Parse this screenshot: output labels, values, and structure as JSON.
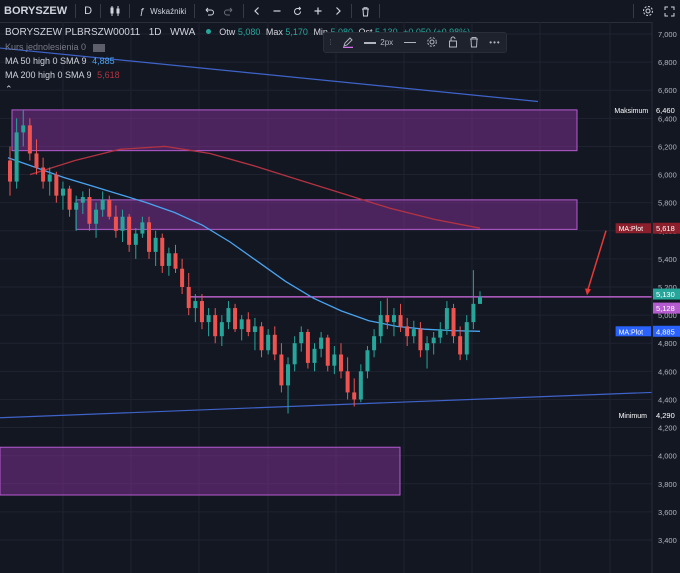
{
  "toolbar": {
    "symbol": "BORYSZEW",
    "chart_type_label": "D",
    "indicators_label": "Wskaźniki"
  },
  "legend": {
    "title": "BORYSZEW PLBRSZW00011",
    "interval": "1D",
    "exchange": "WWA",
    "open_label": "Otw",
    "open_value": "5,080",
    "high_label": "Max",
    "high_value": "5,170",
    "low_label": "Min",
    "low_value": "5,080",
    "close_label": "Ost",
    "close_value": "5,130",
    "change_text": "+0,050 (+0,98%)",
    "row2": "Kurs jednolesienia 0",
    "ma50_label": "MA 50 high 0 SMA 9",
    "ma50_value": "4,885",
    "ma200_label": "MA 200 high 0 SMA 9",
    "ma200_value": "5,618"
  },
  "float_toolbar": {
    "width_label": "2px"
  },
  "labels": {
    "maksimum": "Maksimum",
    "maksimum_value": "6,460",
    "maplot_top": "MA:Plot",
    "maplot_top_value": "5,618",
    "price_close": "5,130",
    "price_line2": "5,128",
    "maplot_bottom": "MA:Plot",
    "maplot_bottom_value": "4,885",
    "minimum": "Minimum",
    "minimum_value": "4,290"
  },
  "colors": {
    "background": "#131722",
    "up": "#26a69a",
    "down": "#ef5350",
    "ma50": "#4aa3f0",
    "ma200": "#b33342",
    "zone_fill": "#7b2f8e",
    "zone_border": "#b55bd0",
    "trendline": "#3f63c9",
    "hline": "#d66ee8",
    "arrow": "#e53935"
  },
  "chart_data": {
    "type": "candlestick",
    "ylim": [
      3.4,
      7.0
    ],
    "yticks": [
      "3,400",
      "3,600",
      "3,800",
      "4,000",
      "4,200",
      "4,400",
      "4,600",
      "4,800",
      "5,000",
      "5,200",
      "5,400",
      "5,600",
      "5,800",
      "6,000",
      "6,200",
      "6,400",
      "6,600",
      "6,800",
      "7,000"
    ],
    "yticks_values": [
      3.4,
      3.6,
      3.8,
      4.0,
      4.2,
      4.4,
      4.6,
      4.8,
      5.0,
      5.2,
      5.4,
      5.6,
      5.8,
      6.0,
      6.2,
      6.4,
      6.6,
      6.8,
      7.0
    ],
    "candles": [
      [
        6.1,
        6.2,
        5.85,
        5.95
      ],
      [
        5.95,
        6.4,
        5.9,
        6.3
      ],
      [
        6.3,
        6.46,
        6.2,
        6.35
      ],
      [
        6.35,
        6.4,
        6.1,
        6.15
      ],
      [
        6.15,
        6.25,
        6.0,
        6.05
      ],
      [
        6.05,
        6.12,
        5.9,
        5.95
      ],
      [
        5.95,
        6.05,
        5.85,
        6.0
      ],
      [
        6.0,
        6.02,
        5.8,
        5.85
      ],
      [
        5.85,
        5.95,
        5.75,
        5.9
      ],
      [
        5.9,
        5.92,
        5.7,
        5.75
      ],
      [
        5.75,
        5.85,
        5.6,
        5.8
      ],
      [
        5.8,
        5.88,
        5.72,
        5.84
      ],
      [
        5.84,
        5.9,
        5.6,
        5.65
      ],
      [
        5.65,
        5.8,
        5.55,
        5.75
      ],
      [
        5.75,
        5.88,
        5.7,
        5.82
      ],
      [
        5.82,
        5.85,
        5.68,
        5.7
      ],
      [
        5.7,
        5.78,
        5.55,
        5.6
      ],
      [
        5.6,
        5.75,
        5.52,
        5.7
      ],
      [
        5.7,
        5.72,
        5.45,
        5.5
      ],
      [
        5.5,
        5.62,
        5.4,
        5.58
      ],
      [
        5.58,
        5.7,
        5.55,
        5.66
      ],
      [
        5.66,
        5.7,
        5.4,
        5.45
      ],
      [
        5.45,
        5.6,
        5.35,
        5.55
      ],
      [
        5.55,
        5.58,
        5.3,
        5.35
      ],
      [
        5.35,
        5.48,
        5.28,
        5.44
      ],
      [
        5.44,
        5.5,
        5.3,
        5.33
      ],
      [
        5.33,
        5.4,
        5.15,
        5.2
      ],
      [
        5.2,
        5.3,
        5.0,
        5.05
      ],
      [
        5.05,
        5.15,
        4.95,
        5.1
      ],
      [
        5.1,
        5.15,
        4.9,
        4.95
      ],
      [
        4.95,
        5.05,
        4.85,
        5.0
      ],
      [
        5.0,
        5.05,
        4.8,
        4.85
      ],
      [
        4.85,
        5.0,
        4.78,
        4.95
      ],
      [
        4.95,
        5.1,
        4.9,
        5.05
      ],
      [
        5.05,
        5.08,
        4.88,
        4.9
      ],
      [
        4.9,
        5.0,
        4.82,
        4.97
      ],
      [
        4.97,
        5.02,
        4.85,
        4.88
      ],
      [
        4.88,
        4.98,
        4.75,
        4.92
      ],
      [
        4.92,
        4.95,
        4.7,
        4.75
      ],
      [
        4.75,
        4.9,
        4.72,
        4.86
      ],
      [
        4.86,
        4.92,
        4.68,
        4.72
      ],
      [
        4.72,
        4.8,
        4.45,
        4.5
      ],
      [
        4.5,
        4.7,
        4.3,
        4.65
      ],
      [
        4.65,
        4.85,
        4.6,
        4.8
      ],
      [
        4.8,
        4.92,
        4.74,
        4.88
      ],
      [
        4.88,
        4.9,
        4.62,
        4.66
      ],
      [
        4.66,
        4.8,
        4.6,
        4.76
      ],
      [
        4.76,
        4.88,
        4.7,
        4.84
      ],
      [
        4.84,
        4.86,
        4.6,
        4.64
      ],
      [
        4.64,
        4.78,
        4.58,
        4.72
      ],
      [
        4.72,
        4.8,
        4.55,
        4.6
      ],
      [
        4.6,
        4.7,
        4.4,
        4.45
      ],
      [
        4.45,
        4.55,
        4.35,
        4.4
      ],
      [
        4.4,
        4.65,
        4.38,
        4.6
      ],
      [
        4.6,
        4.78,
        4.55,
        4.75
      ],
      [
        4.75,
        4.9,
        4.7,
        4.85
      ],
      [
        4.85,
        5.1,
        4.8,
        5.0
      ],
      [
        5.0,
        5.12,
        4.9,
        4.95
      ],
      [
        4.95,
        5.05,
        4.85,
        5.0
      ],
      [
        5.0,
        5.08,
        4.88,
        4.92
      ],
      [
        4.92,
        4.98,
        4.78,
        4.85
      ],
      [
        4.85,
        4.96,
        4.8,
        4.9
      ],
      [
        4.9,
        4.95,
        4.7,
        4.75
      ],
      [
        4.75,
        4.85,
        4.62,
        4.8
      ],
      [
        4.8,
        4.88,
        4.72,
        4.84
      ],
      [
        4.84,
        4.95,
        4.8,
        4.9
      ],
      [
        4.9,
        5.1,
        4.86,
        5.05
      ],
      [
        5.05,
        5.08,
        4.8,
        4.85
      ],
      [
        4.85,
        4.92,
        4.68,
        4.72
      ],
      [
        4.72,
        5.0,
        4.68,
        4.95
      ],
      [
        4.95,
        5.32,
        4.9,
        5.08
      ],
      [
        5.08,
        5.17,
        5.08,
        5.13
      ]
    ],
    "ma50": [
      6.12,
      6.05,
      5.98,
      5.92,
      5.86,
      5.8,
      5.73,
      5.64,
      5.52,
      5.38,
      5.24,
      5.12,
      5.03,
      4.96,
      4.92,
      4.9,
      4.89,
      4.885
    ],
    "ma200": [
      6.0,
      6.1,
      6.18,
      6.2,
      6.15,
      6.06,
      5.96,
      5.86,
      5.76,
      5.68,
      5.618
    ],
    "zones": [
      {
        "top": 6.46,
        "bottom": 6.17
      },
      {
        "top": 5.82,
        "bottom": 5.61
      },
      {
        "top": 4.06,
        "bottom": 3.72
      }
    ],
    "hline": 5.13,
    "trendline_top": [
      6.9,
      6.52
    ],
    "trendline_bottom": [
      4.27,
      4.45
    ]
  }
}
